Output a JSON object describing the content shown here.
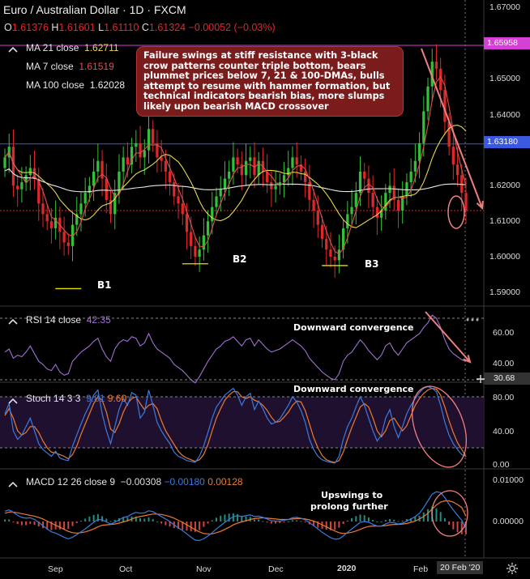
{
  "header": {
    "symbol_label": "Euro / Australian Dollar · 1D · FXCM",
    "open_key": "O",
    "open": "1.61376",
    "high_key": "H",
    "high": "1.61601",
    "low_key": "L",
    "low": "1.61110",
    "close_key": "C",
    "close": "1.61324",
    "change": "−0.00052 (−0.03%)"
  },
  "legend": {
    "ma21_label": "MA 21 close",
    "ma21_value": "1.62711",
    "ma7_label": "MA 7 close",
    "ma7_value": "1.61519",
    "ma100_label": "MA 100 close",
    "ma100_value": "1.62028"
  },
  "annotation": "Failure swings at stiff resistance with 3-black crow patterns counter triple bottom, bears plummet prices below 7, 21 & 100-DMAs, bulls attempt to resume with hammer formation, but technical indicators bearish bias, more slumps likely upon bearish MACD crossover",
  "bottoms": [
    "B1",
    "B2",
    "B3"
  ],
  "price_labels": {
    "resistance": "1.65958",
    "support": "1.63180"
  },
  "price_axis": [
    "1.67000",
    "1.66000",
    "1.65000",
    "1.64000",
    "1.63000",
    "1.62000",
    "1.61000",
    "1.60000",
    "1.59000"
  ],
  "rsi": {
    "label": "RSI 14 close",
    "value": "42.35",
    "note": "Downward convergence",
    "axis": [
      "60.00",
      "40.00"
    ],
    "crosshair_value": "30.68"
  },
  "stoch": {
    "label": "Stoch 14 3 3",
    "k": "9.81",
    "d": "9.60",
    "note": "Downward convergence",
    "axis": [
      "80.00",
      "40.00",
      "0.00"
    ]
  },
  "macd": {
    "label": "MACD 12 26 close 9",
    "hist": "−0.00308",
    "macd": "−0.00180",
    "signal": "0.00128",
    "note_line1": "Upswings to",
    "note_line2": "prolong further",
    "axis": [
      "0.01000",
      "0.00000"
    ]
  },
  "time_axis": [
    "Sep",
    "Oct",
    "Nov",
    "Dec",
    "2020",
    "Feb"
  ],
  "date_badge": "20 Feb '20",
  "colors": {
    "up": "#33c13a",
    "down": "#e0282a",
    "ma21": "#e8d84a",
    "ma7": "#e05050",
    "ma100": "#e8e8e8",
    "resistance": "#d43fd4",
    "support": "#3a58e0",
    "rsi": "#a070d0",
    "k": "#3b7be0",
    "d": "#ee7b30"
  },
  "chart_data": {
    "type": "candlestick",
    "symbol": "EURAUD",
    "timeframe": "1D",
    "x": [
      "Sep",
      "Oct",
      "Nov",
      "Dec",
      "2020",
      "Feb"
    ],
    "close": [
      1.628,
      1.631,
      1.62,
      1.619,
      1.621,
      1.623,
      1.625,
      1.622,
      1.615,
      1.612,
      1.61,
      1.608,
      1.611,
      1.607,
      1.604,
      1.603,
      1.609,
      1.612,
      1.615,
      1.618,
      1.62,
      1.624,
      1.627,
      1.622,
      1.616,
      1.612,
      1.618,
      1.624,
      1.628,
      1.626,
      1.631,
      1.632,
      1.628,
      1.63,
      1.636,
      1.632,
      1.628,
      1.627,
      1.624,
      1.621,
      1.617,
      1.615,
      1.612,
      1.607,
      1.603,
      1.6,
      1.602,
      1.606,
      1.61,
      1.614,
      1.617,
      1.619,
      1.622,
      1.624,
      1.628,
      1.626,
      1.623,
      1.627,
      1.628,
      1.623,
      1.627,
      1.624,
      1.621,
      1.619,
      1.62,
      1.621,
      1.623,
      1.625,
      1.628,
      1.626,
      1.624,
      1.621,
      1.616,
      1.613,
      1.609,
      1.605,
      1.602,
      1.6,
      1.599,
      1.602,
      1.608,
      1.612,
      1.614,
      1.618,
      1.624,
      1.622,
      1.618,
      1.614,
      1.611,
      1.613,
      1.618,
      1.62,
      1.616,
      1.613,
      1.617,
      1.621,
      1.624,
      1.627,
      1.632,
      1.641,
      1.648,
      1.655,
      1.653,
      1.647,
      1.638,
      1.631,
      1.626,
      1.623,
      1.618,
      1.613
    ],
    "resistance": 1.65958,
    "support": 1.6318,
    "bottoms": [
      {
        "label": "B1",
        "value": 1.591
      },
      {
        "label": "B2",
        "value": 1.598
      },
      {
        "label": "B3",
        "value": 1.5975
      }
    ],
    "ylim": [
      1.585,
      1.67
    ],
    "series": [
      {
        "name": "MA 21 close",
        "last": 1.62711
      },
      {
        "name": "MA 7 close",
        "last": 1.61519
      },
      {
        "name": "MA 100 close",
        "last": 1.62028
      }
    ],
    "rsi": [
      48,
      50,
      44,
      46,
      45,
      48,
      52,
      47,
      42,
      40,
      37,
      36,
      40,
      35,
      33,
      34,
      42,
      45,
      48,
      50,
      52,
      55,
      57,
      50,
      45,
      42,
      50,
      54,
      56,
      55,
      58,
      57,
      52,
      54,
      60,
      54,
      50,
      48,
      46,
      44,
      40,
      38,
      36,
      33,
      30,
      28,
      32,
      37,
      42,
      46,
      50,
      52,
      55,
      56,
      58,
      55,
      52,
      56,
      57,
      52,
      56,
      53,
      50,
      48,
      49,
      50,
      52,
      54,
      56,
      54,
      52,
      49,
      44,
      41,
      38,
      35,
      33,
      31,
      30,
      34,
      42,
      46,
      48,
      52,
      56,
      53,
      49,
      46,
      43,
      46,
      52,
      54,
      49,
      46,
      50,
      54,
      56,
      58,
      60,
      64,
      67,
      72,
      70,
      64,
      56,
      50,
      47,
      45,
      43,
      42
    ],
    "rsi_ylim": [
      25,
      80
    ],
    "stoch_k": [
      60,
      72,
      40,
      30,
      35,
      45,
      55,
      40,
      25,
      18,
      14,
      10,
      16,
      8,
      6,
      5,
      22,
      35,
      48,
      60,
      70,
      82,
      88,
      60,
      40,
      25,
      45,
      65,
      78,
      70,
      85,
      82,
      55,
      62,
      88,
      70,
      50,
      40,
      32,
      25,
      15,
      10,
      8,
      5,
      4,
      3,
      10,
      22,
      38,
      55,
      68,
      75,
      82,
      86,
      90,
      82,
      70,
      80,
      84,
      65,
      75,
      66,
      55,
      48,
      50,
      54,
      62,
      70,
      80,
      74,
      64,
      50,
      30,
      18,
      10,
      6,
      4,
      3,
      2,
      10,
      30,
      45,
      55,
      68,
      80,
      70,
      55,
      40,
      28,
      35,
      55,
      65,
      45,
      32,
      45,
      60,
      70,
      78,
      85,
      90,
      92,
      90,
      86,
      70,
      50,
      35,
      25,
      18,
      12,
      9.81
    ],
    "stoch_d": [
      58,
      66,
      55,
      40,
      35,
      38,
      45,
      45,
      38,
      28,
      20,
      15,
      14,
      12,
      10,
      7,
      12,
      22,
      36,
      48,
      60,
      72,
      80,
      76,
      62,
      42,
      38,
      48,
      62,
      72,
      78,
      80,
      72,
      65,
      70,
      72,
      66,
      52,
      40,
      32,
      24,
      16,
      11,
      8,
      6,
      4,
      6,
      12,
      24,
      40,
      55,
      66,
      76,
      82,
      86,
      86,
      80,
      78,
      80,
      76,
      74,
      70,
      64,
      56,
      50,
      51,
      56,
      62,
      70,
      75,
      74,
      64,
      48,
      32,
      20,
      11,
      6,
      4,
      3,
      5,
      15,
      30,
      44,
      56,
      68,
      72,
      68,
      55,
      40,
      33,
      40,
      52,
      55,
      47,
      40,
      46,
      58,
      70,
      78,
      84,
      88,
      90,
      89,
      82,
      68,
      52,
      38,
      26,
      18,
      9.6
    ],
    "stoch_ylim": [
      0,
      95
    ],
    "macd_line": [
      0.0025,
      0.0028,
      0.0022,
      0.0015,
      0.001,
      0.0008,
      0.0009,
      0.0005,
      -0.0002,
      -0.001,
      -0.0018,
      -0.0025,
      -0.0028,
      -0.0033,
      -0.0038,
      -0.0042,
      -0.0038,
      -0.0032,
      -0.0025,
      -0.0018,
      -0.001,
      -0.0002,
      0.0005,
      0.0004,
      -0.0001,
      -0.0006,
      -0.0002,
      0.0004,
      0.001,
      0.0012,
      0.0018,
      0.0022,
      0.002,
      0.0021,
      0.0026,
      0.0024,
      0.0018,
      0.0012,
      0.0006,
      0.0,
      -0.0008,
      -0.0015,
      -0.0022,
      -0.003,
      -0.0038,
      -0.0045,
      -0.0046,
      -0.0042,
      -0.0035,
      -0.0027,
      -0.0018,
      -0.001,
      -0.0002,
      0.0005,
      0.0012,
      0.0014,
      0.0012,
      0.0014,
      0.0016,
      0.0012,
      0.0013,
      0.001,
      0.0006,
      0.0002,
      0.0001,
      0.0001,
      0.0003,
      0.0005,
      0.0009,
      0.001,
      0.0008,
      0.0004,
      -0.0003,
      -0.001,
      -0.0018,
      -0.0026,
      -0.0033,
      -0.0039,
      -0.0043,
      -0.0042,
      -0.0035,
      -0.0026,
      -0.0018,
      -0.001,
      -0.0002,
      0.0,
      -0.0002,
      -0.0007,
      -0.0011,
      -0.0011,
      -0.0006,
      -0.0002,
      -0.0003,
      -0.0006,
      -0.0004,
      0.0001,
      0.0006,
      0.0012,
      0.002,
      0.0034,
      0.005,
      0.0066,
      0.0072,
      0.007,
      0.0058,
      0.0042,
      0.0028,
      0.0015,
      0.0003,
      -0.0018
    ],
    "macd_signal": [
      0.002,
      0.0023,
      0.0023,
      0.0021,
      0.0019,
      0.0017,
      0.0015,
      0.0013,
      0.001,
      0.0006,
      0.0001,
      -0.0004,
      -0.0009,
      -0.0014,
      -0.0019,
      -0.0024,
      -0.0027,
      -0.0028,
      -0.0027,
      -0.0025,
      -0.0022,
      -0.0018,
      -0.0013,
      -0.0009,
      -0.0008,
      -0.0007,
      -0.0006,
      -0.0004,
      -0.0001,
      0.0002,
      0.0006,
      0.001,
      0.0012,
      0.0014,
      0.0016,
      0.0018,
      0.0018,
      0.0017,
      0.0015,
      0.0012,
      0.0008,
      0.0003,
      -0.0002,
      -0.0008,
      -0.0014,
      -0.002,
      -0.0025,
      -0.0029,
      -0.003,
      -0.003,
      -0.0027,
      -0.0024,
      -0.0019,
      -0.0014,
      -0.0008,
      -0.0004,
      -0.0001,
      0.0002,
      0.0005,
      0.0007,
      0.0008,
      0.0009,
      0.0008,
      0.0007,
      0.0006,
      0.0005,
      0.0005,
      0.0005,
      0.0006,
      0.0007,
      0.0007,
      0.0006,
      0.0004,
      0.0001,
      -0.0003,
      -0.0008,
      -0.0013,
      -0.0018,
      -0.0023,
      -0.0027,
      -0.0029,
      -0.0028,
      -0.0026,
      -0.0023,
      -0.0019,
      -0.0015,
      -0.0012,
      -0.0011,
      -0.0011,
      -0.0011,
      -0.001,
      -0.0008,
      -0.0007,
      -0.0007,
      -0.0006,
      -0.0005,
      -0.0002,
      0.0001,
      0.0006,
      0.0012,
      0.002,
      0.003,
      0.004,
      0.0047,
      0.005,
      0.005,
      0.0047,
      0.0041,
      0.0034,
      0.0013
    ],
    "macd_ylim": [
      -0.0065,
      0.012
    ]
  }
}
